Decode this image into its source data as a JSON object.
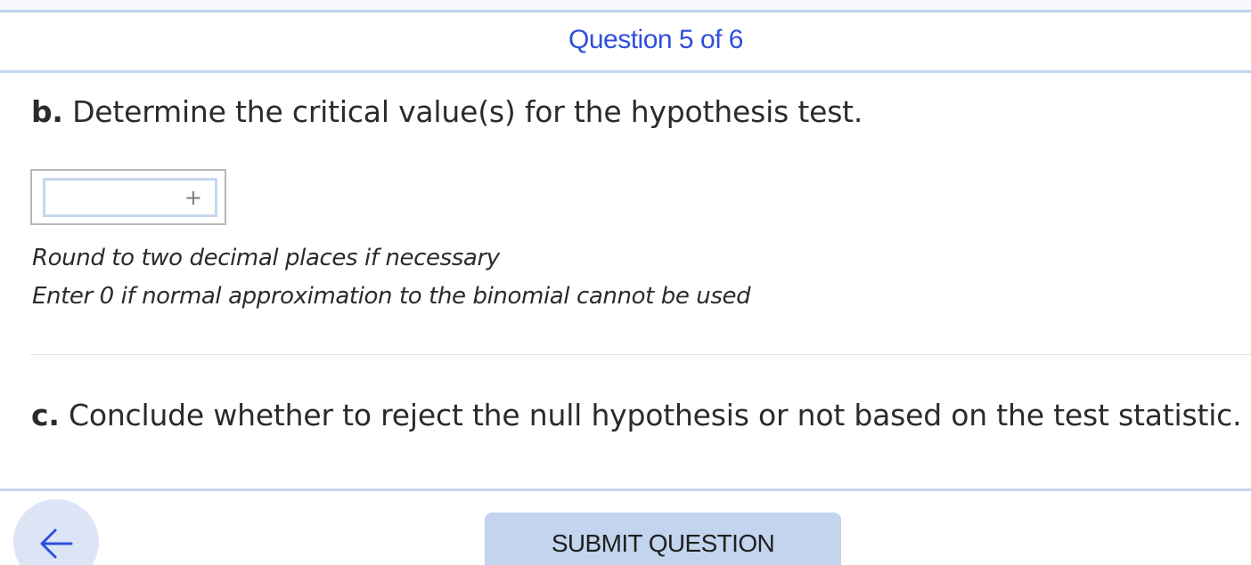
{
  "header": {
    "question_counter": "Question 5 of 6"
  },
  "part_b": {
    "letter": "b.",
    "prompt": "Determine the critical value(s) for the hypothesis test.",
    "answer_value": "",
    "add_icon": "plus-icon",
    "hints": [
      "Round to two decimal places if necessary",
      "Enter 0 if normal approximation to the binomial cannot be used"
    ]
  },
  "part_c": {
    "letter": "c.",
    "prompt": "Conclude whether to reject the null hypothesis or not based on the test statistic."
  },
  "footer": {
    "back_icon": "arrow-left-icon",
    "submit_label": "SUBMIT QUESTION"
  },
  "colors": {
    "accent": "#2f4fdc",
    "rule": "#c2d4ee",
    "button_bg": "#c2d4ee",
    "back_button_bg": "#dbe5f6"
  }
}
